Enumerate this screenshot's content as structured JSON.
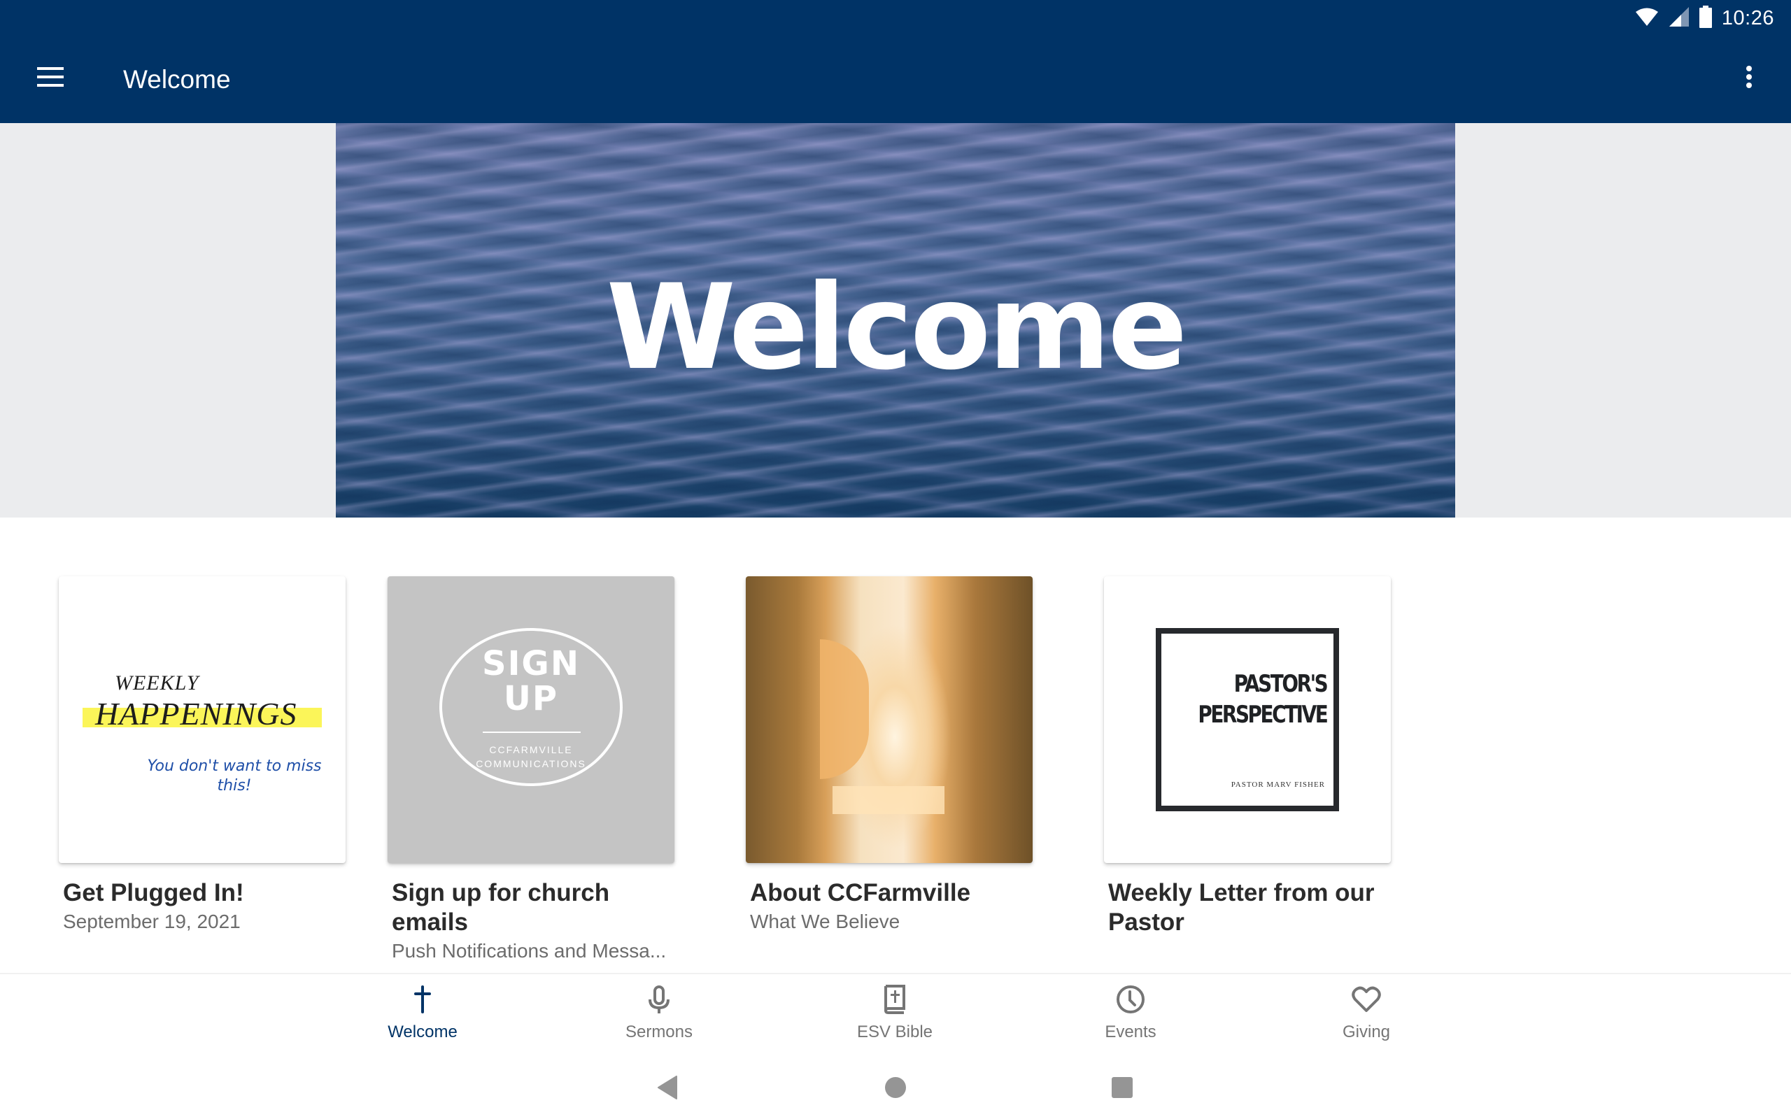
{
  "status_bar": {
    "time": "10:26",
    "icons": [
      "wifi-icon",
      "cell-signal-icon",
      "battery-icon"
    ]
  },
  "app_bar": {
    "title": "Welcome",
    "menu_icon": "hamburger-menu-icon",
    "overflow_icon": "more-vert-icon"
  },
  "hero": {
    "text": "Welcome"
  },
  "cards": [
    {
      "title": "Get Plugged In!",
      "subtitle": "September 19, 2021",
      "image": {
        "line1": "WEEKLY",
        "line2": "HAPPENINGS",
        "line3": "You don't want to miss this!"
      }
    },
    {
      "title": "Sign up for church emails",
      "subtitle": "Push Notifications and Messa...",
      "image": {
        "line1": "SIGN",
        "line2": "UP",
        "line3": "CCFARMVILLE",
        "line4": "COMMUNICATIONS"
      }
    },
    {
      "title": "About CCFarmville",
      "subtitle": "What We Believe",
      "image": {}
    },
    {
      "title": "Weekly Letter from our Pastor",
      "subtitle": "",
      "image": {
        "line1": "PASTOR'S",
        "line2": "PERSPECTIVE",
        "line3": "PASTOR MARV FISHER"
      }
    }
  ],
  "bottom_nav": {
    "items": [
      {
        "label": "Welcome",
        "icon": "cross-icon",
        "active": true
      },
      {
        "label": "Sermons",
        "icon": "microphone-icon",
        "active": false
      },
      {
        "label": "ESV Bible",
        "icon": "bible-icon",
        "active": false
      },
      {
        "label": "Events",
        "icon": "clock-icon",
        "active": false
      },
      {
        "label": "Giving",
        "icon": "heart-icon",
        "active": false
      }
    ]
  },
  "system_nav": {
    "buttons": [
      "back",
      "home",
      "recents"
    ]
  },
  "colors": {
    "primary": "#003366",
    "inactive": "#757575",
    "hero_background": "#ebecee"
  }
}
